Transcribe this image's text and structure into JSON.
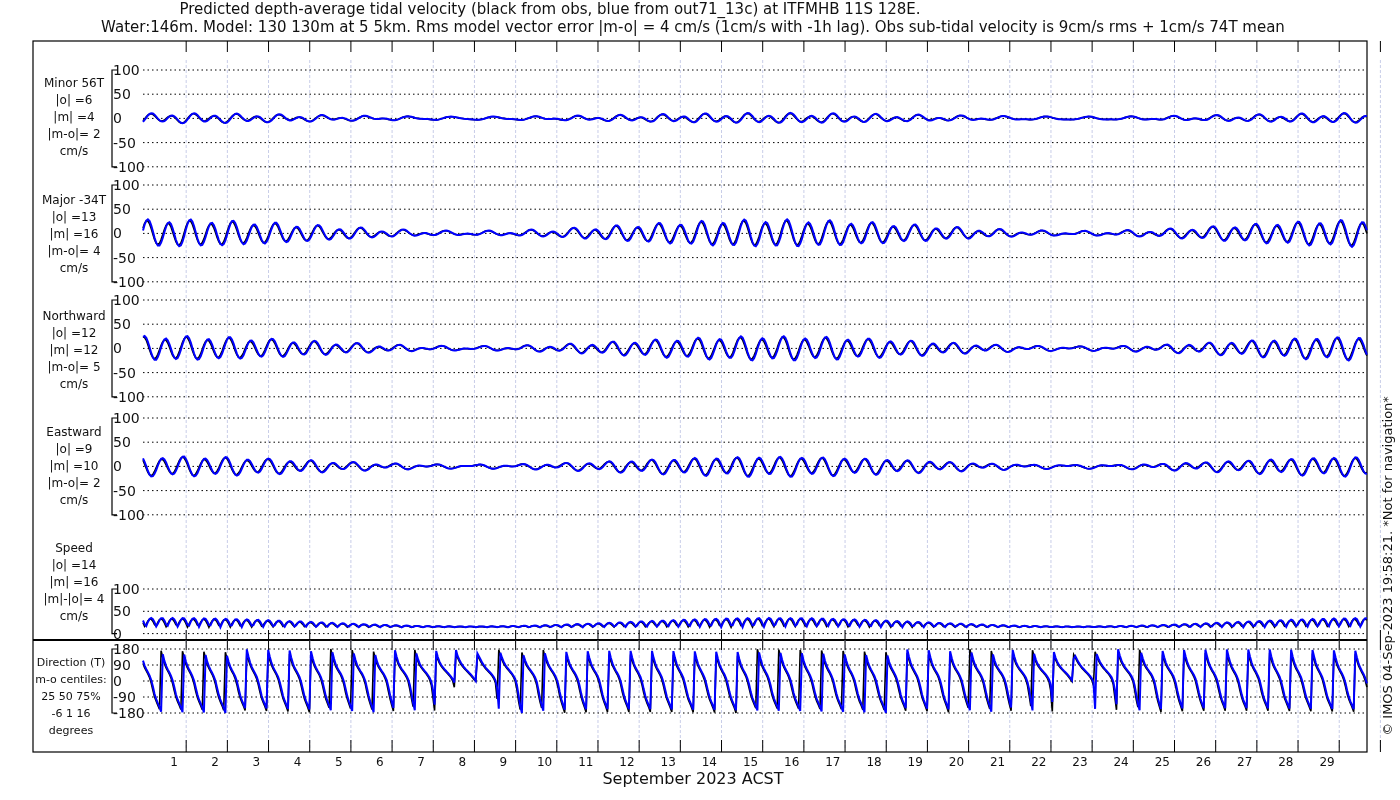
{
  "title_lines": [
    "Predicted depth-average tidal velocity (black from obs, blue from out71_13c) at ITFMHB 11S 128E.",
    "Water:146m. Model: 130 130m at 5 5km. Rms model vector error |m-o| = 4 cm/s (1cm/s with -1h lag). Obs sub-tidal velocity is 9cm/s rms + 1cm/s 74T mean"
  ],
  "panels": [
    {
      "kind": "velocity",
      "label_lines": [
        "Minor 56T",
        "|o| =6",
        "|m| =4",
        "|m-o|= 2",
        "cm/s"
      ],
      "yticks": [
        "100",
        "50",
        "0",
        "-50",
        "-100"
      ]
    },
    {
      "kind": "velocity",
      "label_lines": [
        "Major -34T",
        "|o| =13",
        "|m| =16",
        "|m-o|= 4",
        "cm/s"
      ],
      "yticks": [
        "100",
        "50",
        "0",
        "-50",
        "-100"
      ]
    },
    {
      "kind": "velocity",
      "label_lines": [
        "Northward",
        "|o| =12",
        "|m| =12",
        "|m-o|= 5",
        "cm/s"
      ],
      "yticks": [
        "100",
        "50",
        "0",
        "-50",
        "-100"
      ]
    },
    {
      "kind": "velocity",
      "label_lines": [
        "Eastward",
        "|o| =9",
        "|m| =10",
        "|m-o|= 2",
        "cm/s"
      ],
      "yticks": [
        "100",
        "50",
        "0",
        "-50",
        "-100"
      ]
    },
    {
      "kind": "speed",
      "label_lines": [
        "Speed",
        "|o| =14",
        "|m| =16",
        "|m|-|o|= 4",
        "cm/s"
      ],
      "yticks": [
        "100",
        "50",
        "0"
      ]
    },
    {
      "kind": "direction",
      "label_lines": [
        "Direction (T)",
        "m-o centiles:",
        "25  50  75%",
        "-6   1  16",
        "degrees"
      ],
      "yticks": [
        "180",
        "90",
        "0",
        "-90",
        "-180"
      ]
    }
  ],
  "day_labels": [
    "1",
    "2",
    "3",
    "4",
    "5",
    "6",
    "7",
    "8",
    "9",
    "10",
    "11",
    "12",
    "13",
    "14",
    "15",
    "16",
    "17",
    "18",
    "19",
    "20",
    "21",
    "22",
    "23",
    "24",
    "25",
    "26",
    "27",
    "28",
    "29"
  ],
  "xlabel": "September 2023 ACST",
  "credit": "© IMOS 04-Sep-2023 19:58:21. *Not for navigation*"
}
